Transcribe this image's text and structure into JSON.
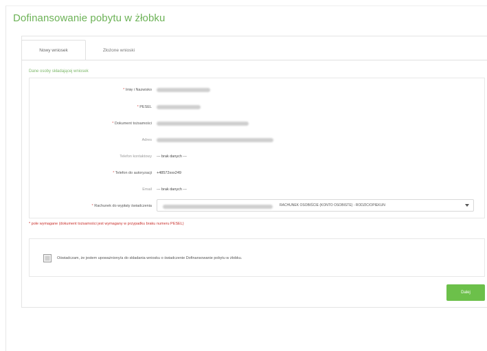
{
  "page": {
    "title": "Dofinansowanie pobytu w żłobku"
  },
  "tabs": [
    {
      "label": "Nowy wniosek",
      "active": true
    },
    {
      "label": "Złożone wnioski",
      "active": false
    }
  ],
  "form": {
    "section_label": "Dane osoby składającej wniosek",
    "fields": {
      "name": {
        "label": "Imię i Nazwisko",
        "required": true
      },
      "pesel": {
        "label": "PESEL",
        "required": true
      },
      "document": {
        "label": "Dokument tożsamości",
        "required": true
      },
      "address": {
        "label": "Adres",
        "required": false
      },
      "phone_contact": {
        "label": "Telefon kontaktowy",
        "required": false,
        "value": "--- brak danych ---"
      },
      "phone_auth": {
        "label": "Telefon do autoryzacji",
        "required": true,
        "value": "+48572xxx249"
      },
      "email": {
        "label": "Email",
        "required": false,
        "value": "--- brak danych ---"
      },
      "payout_account": {
        "label": "Rachunek do wypłaty świadczenia",
        "required": true,
        "selected_text": "RACHUNEK OSOBIŚCIE (KONTO OSOBISTE) - RODZIC/OPIEKUN"
      }
    },
    "required_mark": "*"
  },
  "note": "* pole wymagane (dokument tożsamości jest wymagany w przypadku braku numeru PESEL)",
  "consent": {
    "text": "Oświadczam, że jestem upoważniony/a do składania wniosku o świadczenie Dofinansowanie pobytu w żłobku."
  },
  "actions": {
    "next_label": "Dalej"
  },
  "colors": {
    "accent_green": "#6cb256",
    "button_green": "#6cc04a",
    "required_red": "#d9534f"
  }
}
